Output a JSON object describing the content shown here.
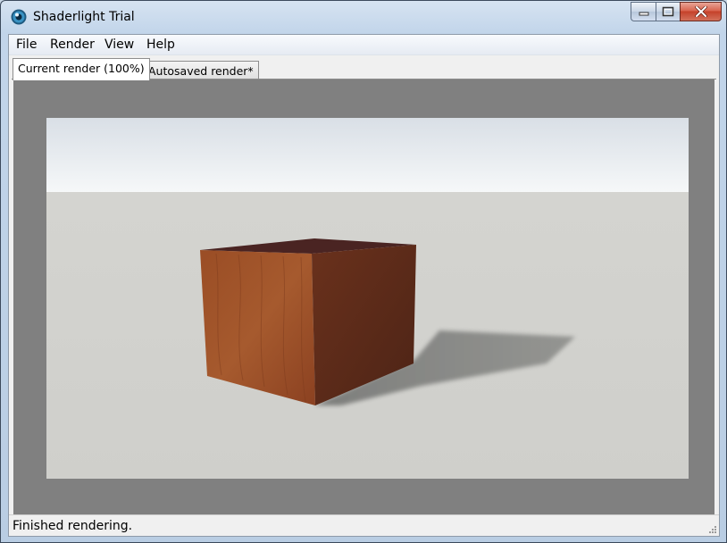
{
  "window": {
    "title": "Shaderlight Trial",
    "icon": "shaderlight-eye-icon",
    "buttons": [
      "minimize-icon",
      "maximize-icon",
      "close-icon"
    ]
  },
  "menu": {
    "items": [
      {
        "label": "File"
      },
      {
        "label": "Render"
      },
      {
        "label": "View"
      },
      {
        "label": "Help"
      }
    ]
  },
  "tabs": [
    {
      "label": "Current render (100%)",
      "active": true
    },
    {
      "label": "Autosaved render*",
      "active": false
    }
  ],
  "status": {
    "text": "Finished rendering."
  },
  "colors": {
    "viewport_bg": "#808080",
    "wood_front": "#9b4e25",
    "wood_side": "#5e2d1a",
    "wood_top": "#4a2422",
    "floor": "#d2d2cd",
    "sky": "#f0f3f6"
  }
}
